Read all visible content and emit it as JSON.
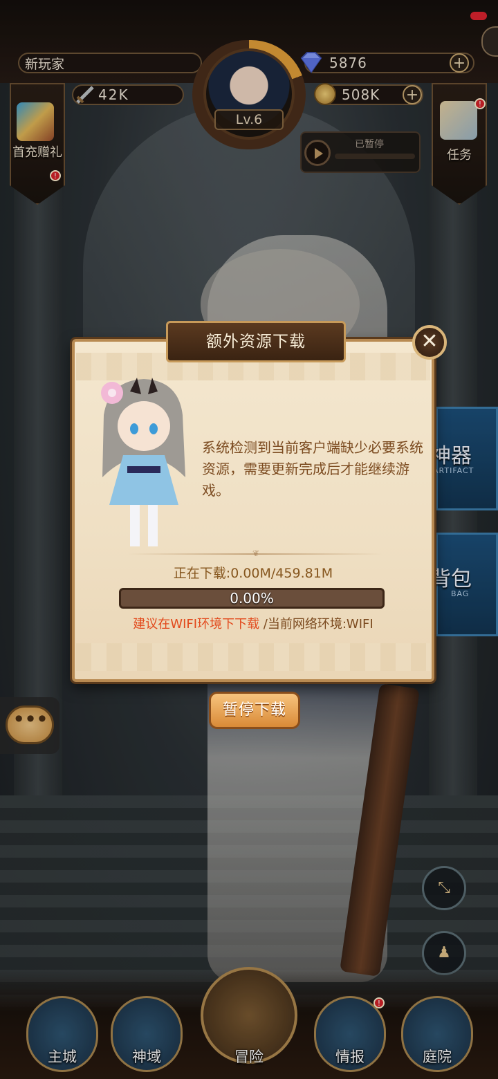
{
  "hud": {
    "player_name": "新玩家",
    "gems": "5876",
    "power": "42K",
    "gold": "508K",
    "level": "Lv.6",
    "music_status": "已暂停"
  },
  "side_buttons": {
    "left_label": "首充赠礼",
    "right_label": "任务"
  },
  "right_tabs": [
    {
      "label": "神器",
      "sub": "ARTIFACT"
    },
    {
      "label": "背包",
      "sub": "BAG"
    }
  ],
  "dialog": {
    "title": "额外资源下载",
    "close_glyph": "✕",
    "message": "系统检测到当前客户端缺少必要系统资源，需要更新完成后才能继续游戏。",
    "status": "正在下载:0.00M/459.81M",
    "progress_fraction": 0.0,
    "progress_text": "0.00%",
    "hint_warn": "建议在WIFI环境下下载",
    "hint_network": " /当前网络环境:WIFI"
  },
  "pause_button": "暂停下载",
  "chat_glyph": "•••",
  "bottom_nav": [
    {
      "label": "主城",
      "icon": "castle-icon"
    },
    {
      "label": "神域",
      "icon": "tree-icon"
    },
    {
      "label": "冒险",
      "icon": "map-icon"
    },
    {
      "label": "情报",
      "icon": "helmet-icon"
    },
    {
      "label": "庭院",
      "icon": "courtyard-icon"
    }
  ],
  "colors": {
    "accent": "#e2a648",
    "warning_text": "#e2491c",
    "dialog_text": "#7b4a1f"
  }
}
